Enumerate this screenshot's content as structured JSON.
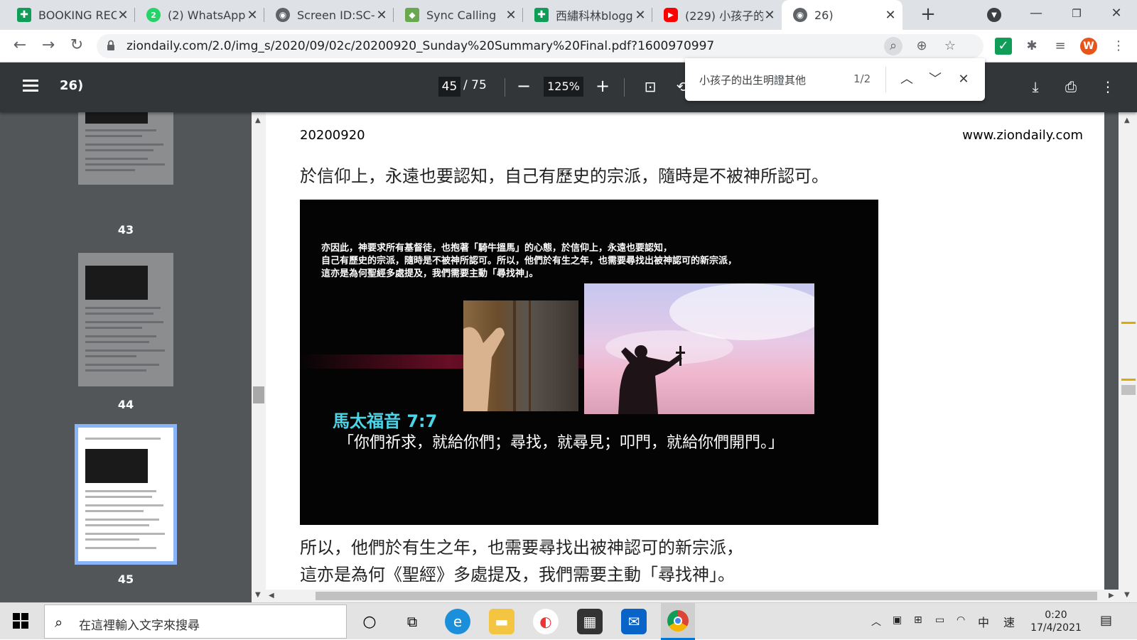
{
  "tabs": [
    {
      "title": "BOOKING REC",
      "icon": "sheets-icon",
      "color": "#0f9d58"
    },
    {
      "title": "(2) WhatsApp",
      "icon": "whatsapp-icon",
      "color": "#25d366"
    },
    {
      "title": "Screen ID:SC-",
      "icon": "globe-icon",
      "color": "#5f6368"
    },
    {
      "title": "Sync Calling",
      "icon": "sync-icon",
      "color": "#6aa84f"
    },
    {
      "title": "西繡科林blogg",
      "icon": "sheets-icon",
      "color": "#0f9d58"
    },
    {
      "title": "(229) 小孩子的",
      "icon": "youtube-icon",
      "color": "#ff0000"
    },
    {
      "title": "26)",
      "icon": "globe-icon",
      "color": "#5f6368"
    }
  ],
  "address": {
    "url": "ziondaily.com/2.0/img_s/2020/09/02c/20200920_Sunday%20Summary%20Final.pdf?1600970997"
  },
  "profile": {
    "initial": "W",
    "color": "#e8541a"
  },
  "pdf": {
    "title": "26)",
    "current_page": "45",
    "total_pages": "/ 75",
    "zoom": "125%"
  },
  "find": {
    "query": "小孩子的出生明證其他",
    "count": "1/2"
  },
  "thumbnails": [
    {
      "label": "43"
    },
    {
      "label": "44"
    },
    {
      "label": "45"
    }
  ],
  "document": {
    "header_left": "20200920",
    "header_right": "www.ziondaily.com",
    "para1": "於信仰上，永遠也要認知，自己有歷史的宗派，隨時是不被神所認可。",
    "slide_lines": [
      "亦因此，神要求所有基督徒，也抱著「騎牛搵馬」的心態，於信仰上，永遠也要認知，",
      "自己有歷史的宗派，隨時是不被神所認可。所以，他們於有生之年，也需要尋找出被神認可的新宗派，",
      "這亦是為何聖經多處提及，我們需要主動「尋找神」。"
    ],
    "slide_ref": "馬太福音 7:7",
    "slide_quote": "「你們祈求，就給你們；尋找，就尋見；叩門，就給你們開門。」",
    "para2_lines": [
      "所以，他們於有生之年，也需要尋找出被神認可的新宗派，",
      "這亦是為何《聖經》多處提及，我們需要主動「尋找神」。"
    ]
  },
  "taskbar": {
    "search_placeholder": "在這裡輸入文字來搜尋",
    "ime_lang": "中",
    "ime_mode": "速",
    "time": "0:20",
    "date": "17/4/2021"
  }
}
